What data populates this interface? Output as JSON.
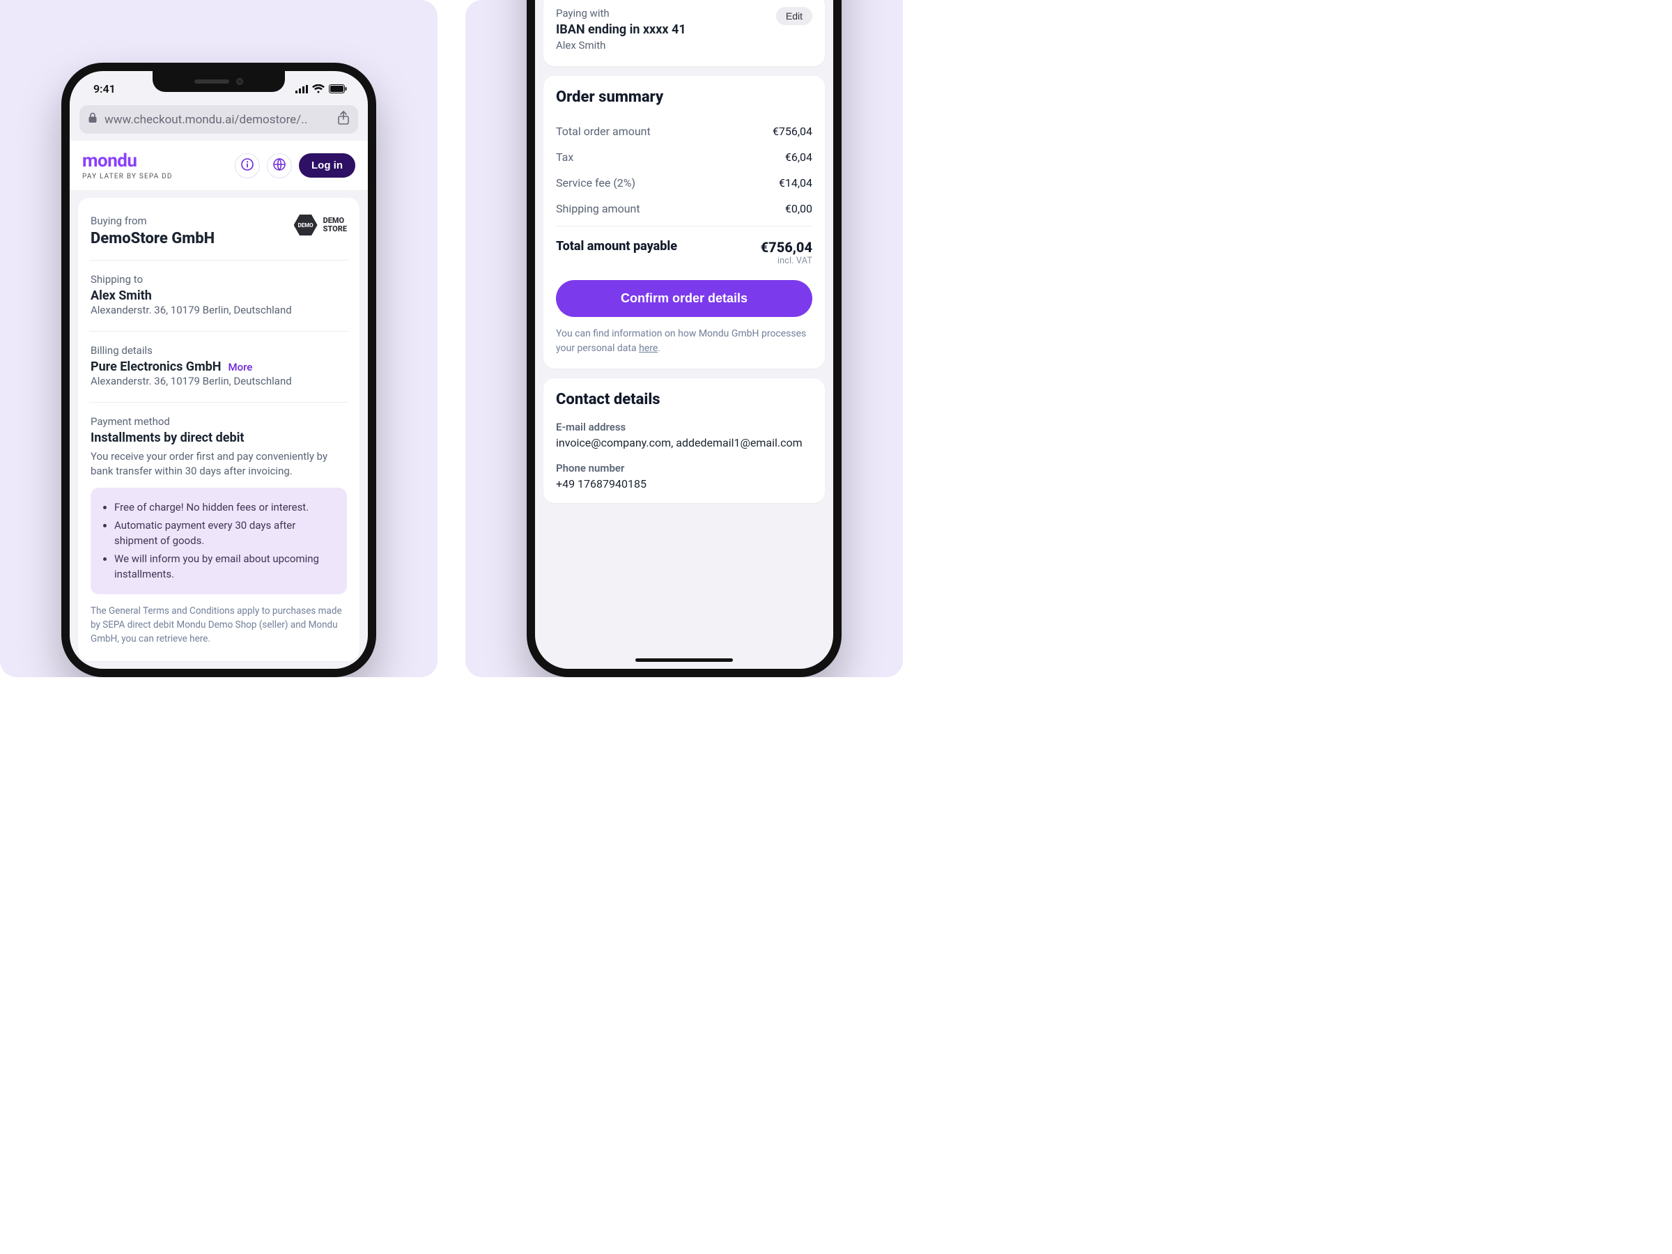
{
  "statusbar": {
    "time": "9:41"
  },
  "urlbar": {
    "url": "www.checkout.mondu.ai/demostore/.."
  },
  "header": {
    "brand": "mondu",
    "tagline": "PAY LATER BY SEPA DD",
    "login": "Log in"
  },
  "buying": {
    "label": "Buying from",
    "merchant": "DemoStore GmbH",
    "badge_tag": "DEMO",
    "badge_line1": "DEMO",
    "badge_line2": "STORE"
  },
  "shipping": {
    "label": "Shipping to",
    "name": "Alex Smith",
    "address": "Alexanderstr. 36, 10179 Berlin, Deutschland"
  },
  "billing": {
    "label": "Billing details",
    "company": "Pure Electronics GmbH",
    "more": "More",
    "address": "Alexanderstr. 36, 10179 Berlin, Deutschland"
  },
  "payment": {
    "label": "Payment method",
    "title": "Installments by direct debit",
    "desc": "You receive your order first and pay conveniently by bank transfer within 30 days after invoicing.",
    "bullets": [
      "Free of charge! No hidden fees or interest.",
      "Automatic payment every 30 days after shipment of goods.",
      "We will inform you by email about upcoming installments."
    ],
    "terms": "The General Terms and Conditions apply to purchases made by SEPA direct debit Mondu Demo Shop (seller) and Mondu GmbH, you can retrieve here."
  },
  "paying": {
    "label": "Paying with",
    "iban": "IBAN ending in  xxxx 41",
    "holder": "Alex Smith",
    "edit": "Edit"
  },
  "order": {
    "title": "Order summary",
    "lines": [
      {
        "k": "Total order amount",
        "v": "€756,04"
      },
      {
        "k": "Tax",
        "v": "€6,04"
      },
      {
        "k": "Service fee (2%)",
        "v": "€14,04"
      },
      {
        "k": "Shipping amount",
        "v": "€0,00"
      }
    ],
    "total_label": "Total amount payable",
    "total_value": "€756,04",
    "total_sub": "incl. VAT",
    "confirm": "Confirm order details",
    "policy_pre": "You can find information on how Mondu GmbH processes your personal data ",
    "policy_link": "here",
    "policy_post": "."
  },
  "contact": {
    "title": "Contact details",
    "email_label": "E-mail address",
    "email_value": "invoice@company.com, addedemail1@email.com",
    "phone_label": "Phone number",
    "phone_value": "+49 17687940185"
  }
}
